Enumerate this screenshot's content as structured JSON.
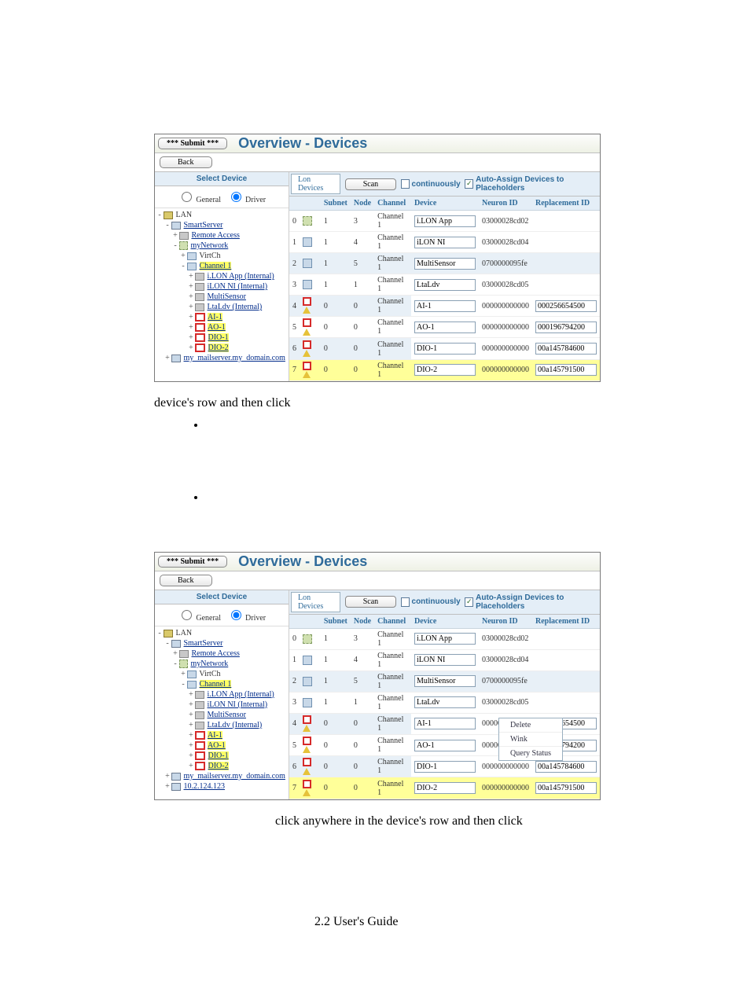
{
  "title": "Overview - Devices",
  "submit": "*** Submit ***",
  "back": "Back",
  "selectDevice": "Select Device",
  "radio": {
    "general": "General",
    "driver": "Driver"
  },
  "tree": [
    {
      "lv": 0,
      "tw": "-",
      "ic": "ic-lan",
      "t": "LAN"
    },
    {
      "lv": 1,
      "tw": "-",
      "ic": "ic-srv",
      "t": "SmartServer",
      "lk": true
    },
    {
      "lv": 2,
      "tw": "+",
      "ic": "ic-dev",
      "t": "Remote Access",
      "lk": true
    },
    {
      "lv": 2,
      "tw": "-",
      "ic": "ic-net",
      "t": "myNetwork",
      "lk": true
    },
    {
      "lv": 3,
      "tw": "+",
      "ic": "ic-ch",
      "t": "VirtCh"
    },
    {
      "lv": 3,
      "tw": "-",
      "ic": "ic-ch",
      "t": "Channel 1",
      "lk": true,
      "hl": true
    },
    {
      "lv": 4,
      "tw": "+",
      "ic": "ic-dev",
      "t": "i.LON App (Internal)",
      "lk": true
    },
    {
      "lv": 4,
      "tw": "+",
      "ic": "ic-dev",
      "t": "iLON NI (Internal)",
      "lk": true
    },
    {
      "lv": 4,
      "tw": "+",
      "ic": "ic-dev",
      "t": "MultiSensor",
      "lk": true
    },
    {
      "lv": 4,
      "tw": "+",
      "ic": "ic-dev",
      "t": "LtaLdv (Internal)",
      "lk": true
    },
    {
      "lv": 4,
      "tw": "+",
      "ic": "ic-r",
      "t": "AI-1",
      "lk": true,
      "hl": true
    },
    {
      "lv": 4,
      "tw": "+",
      "ic": "ic-r",
      "t": "AO-1",
      "lk": true,
      "hl": true
    },
    {
      "lv": 4,
      "tw": "+",
      "ic": "ic-r",
      "t": "DIO-1",
      "lk": true,
      "hl": true
    },
    {
      "lv": 4,
      "tw": "+",
      "ic": "ic-r",
      "t": "DIO-2",
      "lk": true,
      "hl": true
    },
    {
      "lv": 1,
      "tw": "+",
      "ic": "ic-srv",
      "t": "my_mailserver.my_domain.com",
      "lk": true
    }
  ],
  "treeExtra": {
    "lv": 1,
    "tw": "+",
    "ic": "ic-srv",
    "t": "10.2.124.123",
    "lk": true
  },
  "tabs": {
    "main": "Lon Devices",
    "scan": "Scan",
    "cont": "continuously",
    "auto": "Auto-Assign Devices to Placeholders"
  },
  "cols": [
    "",
    "",
    "Subnet",
    "Node",
    "Channel",
    "Device",
    "Neuron ID",
    "Replacement ID"
  ],
  "rows": [
    {
      "n": "0",
      "ic": [
        "g"
      ],
      "s": "1",
      "nd": "3",
      "ch": "Channel 1",
      "dev": "i.LON App",
      "nid": "03000028cd02",
      "rep": ""
    },
    {
      "n": "1",
      "ic": [
        "b"
      ],
      "s": "1",
      "nd": "4",
      "ch": "Channel 1",
      "dev": "iLON NI",
      "nid": "03000028cd04",
      "rep": ""
    },
    {
      "n": "2",
      "ic": [
        "b"
      ],
      "s": "1",
      "nd": "5",
      "ch": "Channel 1",
      "dev": "MultiSensor",
      "nid": "0700000095fe",
      "rep": "",
      "odd": true
    },
    {
      "n": "3",
      "ic": [
        "b"
      ],
      "s": "1",
      "nd": "1",
      "ch": "Channel 1",
      "dev": "LtaLdv",
      "nid": "03000028cd05",
      "rep": ""
    },
    {
      "n": "4",
      "ic": [
        "o",
        "w"
      ],
      "s": "0",
      "nd": "0",
      "ch": "Channel 1",
      "dev": "AI-1",
      "nid": "000000000000",
      "rep": "000256654500",
      "hl": true,
      "odd": true
    },
    {
      "n": "5",
      "ic": [
        "o",
        "w"
      ],
      "s": "0",
      "nd": "0",
      "ch": "Channel 1",
      "dev": "AO-1",
      "nid": "000000000000",
      "rep": "000196794200",
      "hl": true
    },
    {
      "n": "6",
      "ic": [
        "o",
        "w"
      ],
      "s": "0",
      "nd": "0",
      "ch": "Channel 1",
      "dev": "DIO-1",
      "nid": "000000000000",
      "rep": "00a145784600",
      "hl": true,
      "odd": true
    },
    {
      "n": "7",
      "ic": [
        "o",
        "w"
      ],
      "s": "0",
      "nd": "0",
      "ch": "Channel 1",
      "dev": "DIO-2",
      "nid": "000000000000",
      "rep": "00a145791500",
      "hl": true,
      "sel": true
    }
  ],
  "ctx": [
    "Delete",
    "Wink",
    "Query Status"
  ],
  "prose1": "device's row and then click",
  "prose2": "click anywhere in the device's row and then click",
  "foot": "2.2 User's Guide"
}
